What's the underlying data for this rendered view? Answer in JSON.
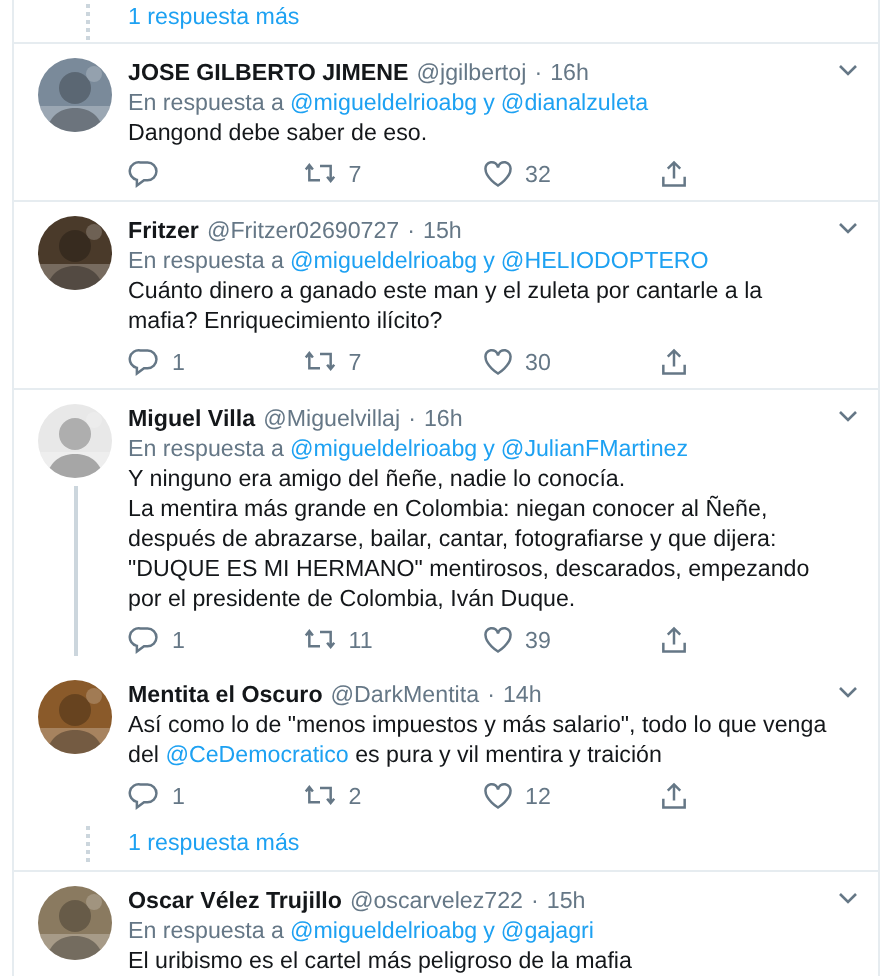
{
  "top_more_replies": "1 respuesta más",
  "tweets": [
    {
      "name": "JOSE GILBERTO JIMENE",
      "handle": "@jgilbertoj",
      "dot": "·",
      "time": "16h",
      "reply_prefix": "En respuesta a",
      "reply_to": [
        "@migueldelrioabg",
        "@dianalzuleta"
      ],
      "reply_joiner": "y",
      "avatar": {
        "kind": "picture",
        "color": "#7a8a9a"
      },
      "body": [
        [
          {
            "kind": "text",
            "text": "Dangond debe saber de eso."
          }
        ]
      ],
      "retweets": "7",
      "likes": "32"
    },
    {
      "name": "Fritzer",
      "handle": "@Fritzer02690727",
      "dot": "·",
      "time": "15h",
      "reply_prefix": "En respuesta a",
      "reply_to": [
        "@migueldelrioabg",
        "@HELIODOPTERO"
      ],
      "reply_joiner": "y",
      "avatar": {
        "kind": "picture",
        "color": "#4a3a2a"
      },
      "body": [
        [
          {
            "kind": "text",
            "text": "Cuánto dinero a ganado este man y el zuleta por cantarle a la mafia? Enriquecimiento ilícito?"
          }
        ]
      ],
      "replies": "1",
      "retweets": "7",
      "likes": "30"
    },
    {
      "name": "Miguel Villa",
      "handle": "@Miguelvillaj",
      "dot": "·",
      "time": "16h",
      "reply_prefix": "En respuesta a",
      "reply_to": [
        "@migueldelrioabg",
        "@JulianFMartinez"
      ],
      "reply_joiner": "y",
      "avatar": {
        "kind": "picture",
        "color": "#e8e8e8"
      },
      "body": [
        [
          {
            "kind": "text",
            "text": "Y ninguno era amigo del ñeñe, nadie lo conocía."
          }
        ],
        [
          {
            "kind": "text",
            "text": "La mentira más grande en Colombia: niegan conocer al Ñeñe, después de abrazarse, bailar, cantar, fotografiarse y que dijera: \"DUQUE ES MI HERMANO\" mentirosos, descarados, empezando por el presidente de Colombia, Iván Duque."
          }
        ]
      ],
      "replies": "1",
      "retweets": "11",
      "likes": "39",
      "thread_line": true
    },
    {
      "name": "Mentita el Oscuro",
      "handle": "@DarkMentita",
      "dot": "·",
      "time": "14h",
      "avatar": {
        "kind": "picture",
        "color": "#8a5a2a"
      },
      "body": [
        [
          {
            "kind": "text",
            "text": "Así como lo de \"menos impuestos y más salario\", todo lo que venga del "
          },
          {
            "kind": "mention",
            "text": "@CeDemocratico"
          },
          {
            "kind": "text",
            "text": " es pura y vil mentira y traición"
          }
        ]
      ],
      "replies": "1",
      "retweets": "2",
      "likes": "12",
      "more_replies": "1 respuesta más"
    },
    {
      "name": "Oscar Vélez Trujillo",
      "handle": "@oscarvelez722",
      "dot": "·",
      "time": "15h",
      "reply_prefix": "En respuesta a",
      "reply_to": [
        "@migueldelrioabg",
        "@gajagri"
      ],
      "reply_joiner": "y",
      "avatar": {
        "kind": "picture",
        "color": "#8a7a60"
      },
      "body": [
        [
          {
            "kind": "text",
            "text": "El uribismo es el cartel más peligroso de la mafia"
          }
        ]
      ]
    }
  ]
}
